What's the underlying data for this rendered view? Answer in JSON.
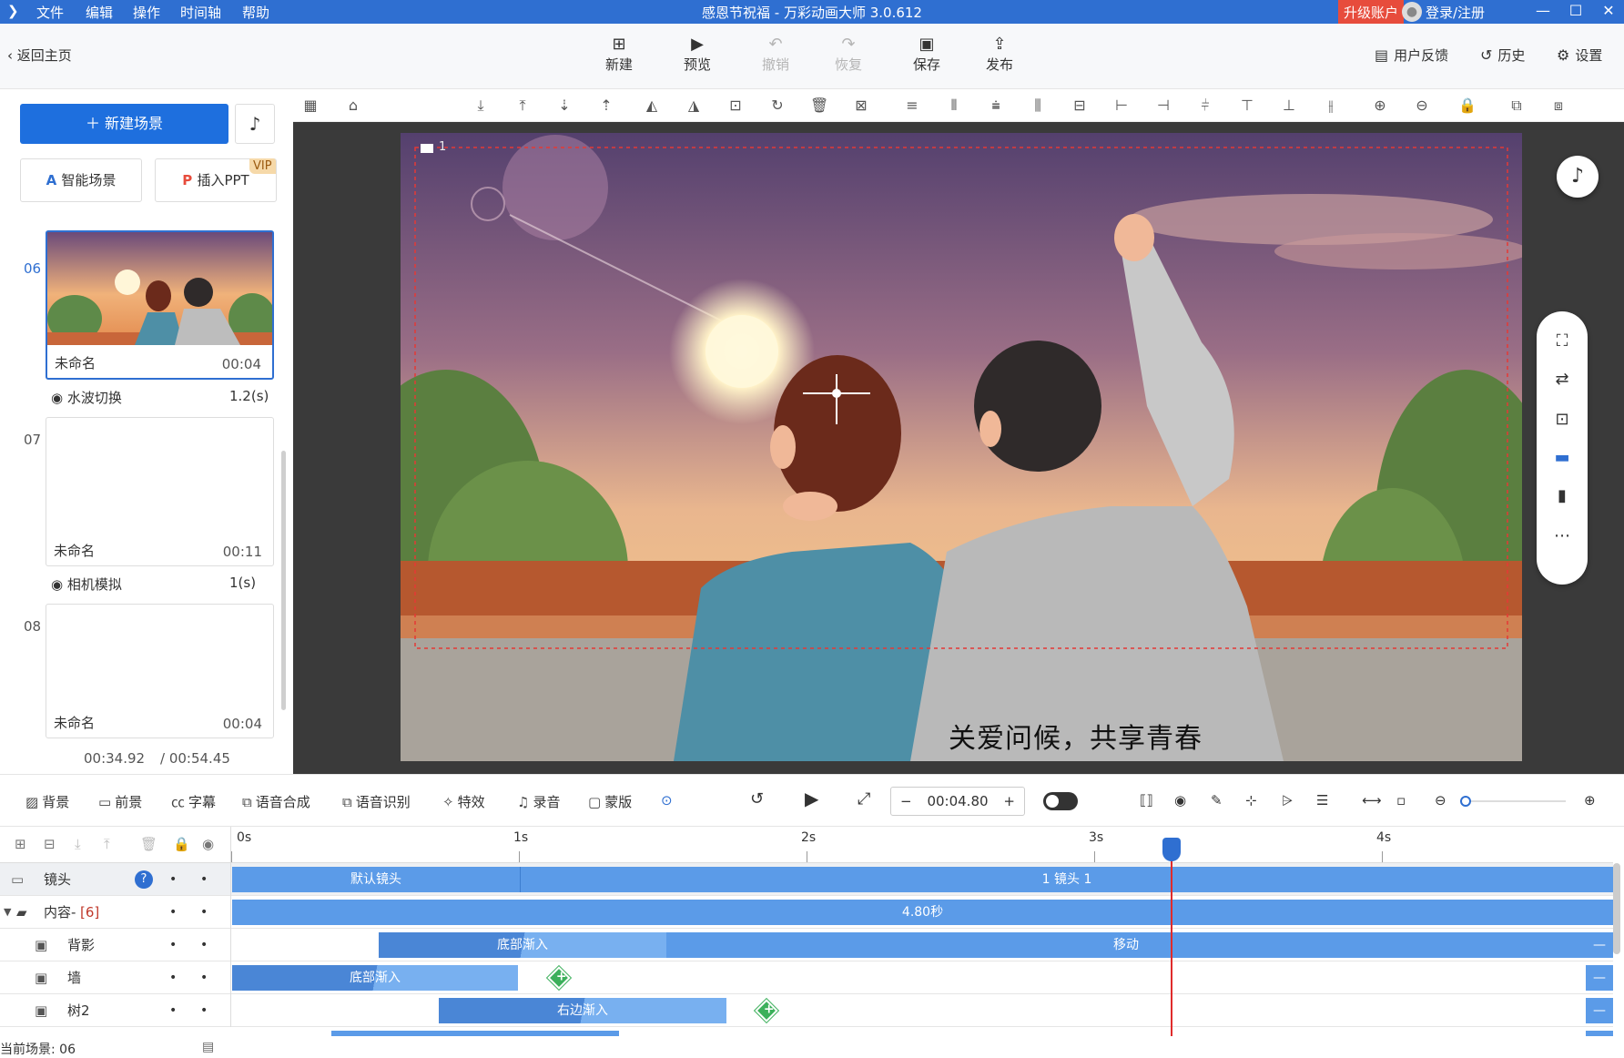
{
  "titlebar": {
    "menus": [
      "文件",
      "编辑",
      "操作",
      "时间轴",
      "帮助"
    ],
    "title": "感恩节祝福 - 万彩动画大师 3.0.612",
    "upgrade": "升级账户",
    "login": "登录/注册"
  },
  "toolbar": {
    "back": "返回主页",
    "new": "新建",
    "preview": "预览",
    "undo": "撤销",
    "redo": "恢复",
    "save": "保存",
    "publish": "发布",
    "feedback": "用户反馈",
    "history": "历史",
    "settings": "设置"
  },
  "left": {
    "new_scene": "新建场景",
    "smart_scene": "智能场景",
    "insert_ppt": "插入PPT",
    "vip": "VIP",
    "scenes": [
      {
        "num": "06",
        "name": "未命名",
        "time": "00:04"
      },
      {
        "num": "07",
        "name": "未命名",
        "time": "00:11"
      },
      {
        "num": "08",
        "name": "未命名",
        "time": "00:04"
      }
    ],
    "transitions": [
      {
        "label": "水波切换",
        "dur": "1.2(s)"
      },
      {
        "label": "相机模拟",
        "dur": "1(s)"
      }
    ],
    "current_time": "00:34.92",
    "total_time": "/ 00:54.45"
  },
  "stage": {
    "subtitle": "关爱问候，共享青春",
    "camera_label": "1"
  },
  "editbar": {
    "background": "背景",
    "foreground": "前景",
    "caption": "字幕",
    "tts": "语音合成",
    "asr": "语音识别",
    "effects": "特效",
    "record": "录音",
    "mask": "蒙版",
    "time": "00:04.80"
  },
  "timeline": {
    "ruler": [
      "0s",
      "1s",
      "2s",
      "3s",
      "4s"
    ],
    "tracks": {
      "camera": {
        "name": "镜头",
        "seg1": "默认镜头",
        "seg2": "1 镜头 1"
      },
      "content": {
        "name": "内容-",
        "count": "[6]",
        "seg": "4.80秒"
      },
      "bg": {
        "name": "背影",
        "seg1": "底部渐入",
        "seg2": "移动"
      },
      "wall": {
        "name": "墙",
        "seg1": "底部渐入"
      },
      "tree": {
        "name": "树2",
        "seg1": "右边渐入"
      }
    },
    "current_scene": "当前场景: 06"
  },
  "colors": {
    "accent": "#2f6fd1",
    "track": "#5b9be8",
    "upgrade": "#e74c3c"
  }
}
